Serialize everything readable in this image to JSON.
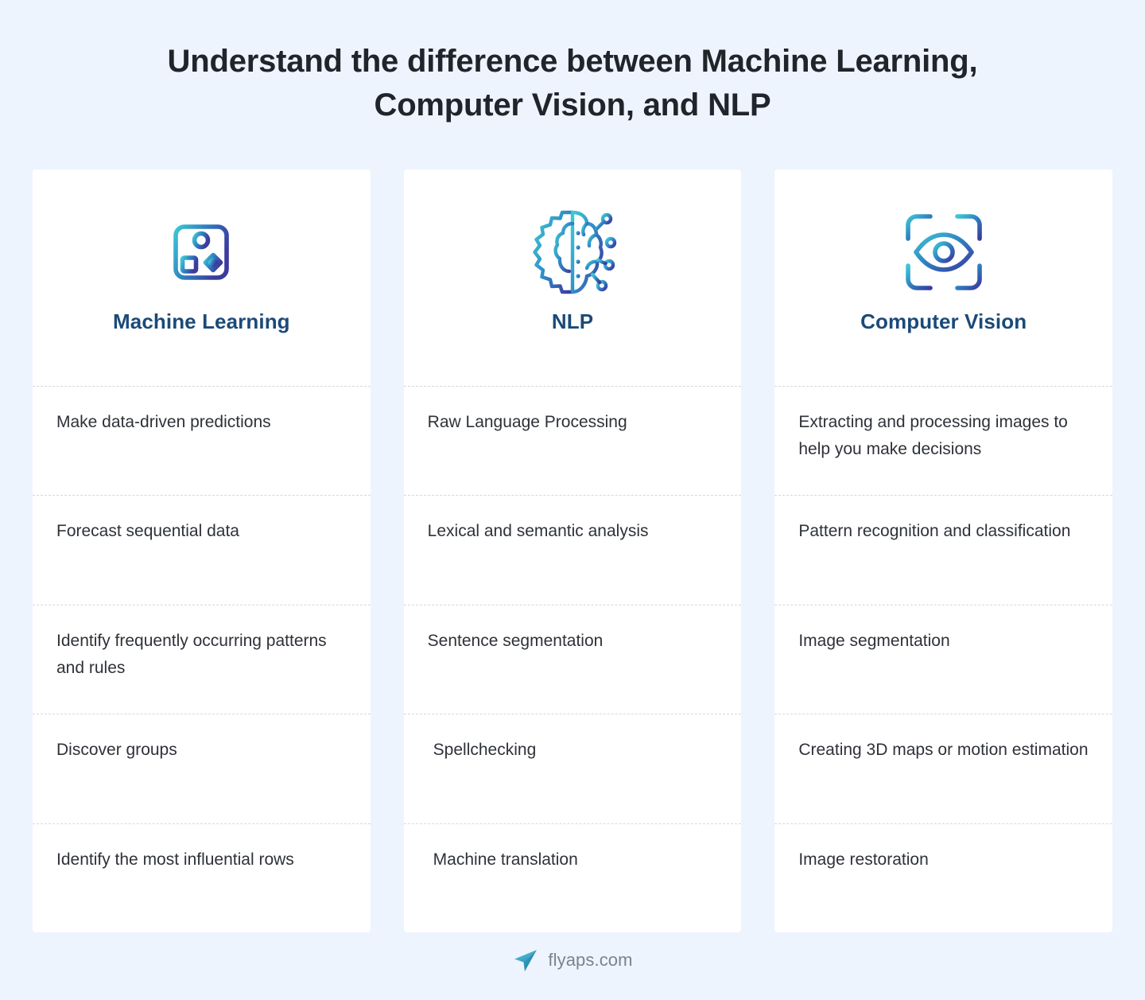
{
  "page": {
    "title": "Understand the difference between Machine Learning, Computer Vision, and NLP",
    "background_color": "#eef4fd",
    "card_background": "#ffffff",
    "heading_color": "#1b4a78",
    "body_text_color": "#2e3238",
    "divider_color": "#d4d7dc",
    "icon_gradient_start": "#3ec6d4",
    "icon_gradient_end": "#3b3b9e"
  },
  "columns": [
    {
      "id": "machine-learning",
      "title": "Machine Learning",
      "icon": "cpu-chip-flowchart-icon",
      "items": [
        "Make data-driven predictions",
        "Forecast sequential data",
        "Identify frequently occurring patterns and rules",
        "Discover groups",
        "Identify the most influential rows"
      ]
    },
    {
      "id": "nlp",
      "title": "NLP",
      "icon": "gear-brain-icon",
      "items": [
        "Raw Language Processing",
        "Lexical and semantic analysis",
        "Sentence segmentation",
        "Spellchecking",
        "Machine translation"
      ]
    },
    {
      "id": "computer-vision",
      "title": "Computer Vision",
      "icon": "eye-scan-frame-icon",
      "items": [
        "Extracting and processing images to help you make decisions",
        "Pattern recognition and classification",
        "Image segmentation",
        "Creating 3D maps or motion estimation",
        "Image restoration"
      ]
    }
  ],
  "footer": {
    "logo": "paper-plane-logo",
    "text": "flyaps.com",
    "logo_color": "#3bb7cf",
    "text_color": "#7b8290"
  }
}
